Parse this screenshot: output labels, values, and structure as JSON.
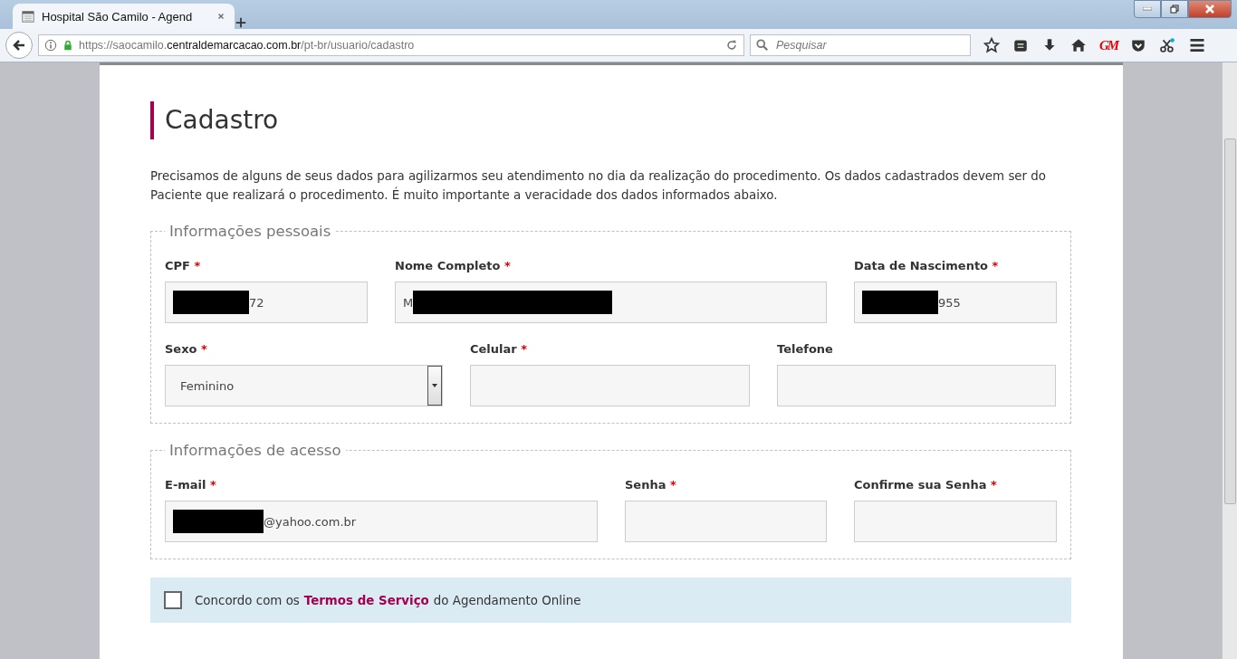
{
  "browser": {
    "tab_title": "Hospital São Camilo - Agend",
    "url": {
      "prefix": "https://saocamilo.",
      "domain": "centraldemarcacao.com.br",
      "path": "/pt-br/usuario/cadastro"
    },
    "search": {
      "placeholder": "Pesquisar"
    },
    "extension_label": "GM"
  },
  "page": {
    "title": "Cadastro",
    "intro": "Precisamos de alguns de seus dados para agilizarmos seu atendimento no dia da realização do procedimento. Os dados cadastrados devem ser do Paciente que realizará o procedimento. É muito importante a veracidade dos dados informados abaixo.",
    "sections": [
      {
        "legend": "Informações pessoais",
        "rows": [
          [
            {
              "kind": "text",
              "label": "CPF",
              "required_mark": "*",
              "value": "72",
              "redacted_before": true
            },
            {
              "kind": "text",
              "label": "Nome Completo",
              "required_mark": "*",
              "value": "M",
              "redacted_after": true
            },
            {
              "kind": "text",
              "label": "Data de Nascimento",
              "required_mark": "*",
              "value": "955",
              "redacted_before": true
            }
          ],
          [
            {
              "kind": "select",
              "label": "Sexo",
              "required_mark": "*",
              "value": "Feminino"
            },
            {
              "kind": "text",
              "label": "Celular",
              "required_mark": "*"
            },
            {
              "kind": "text",
              "label": "Telefone"
            }
          ]
        ]
      },
      {
        "legend": "Informações de acesso",
        "rows": [
          [
            {
              "kind": "text",
              "label": "E-mail",
              "required_mark": "*",
              "value": "@yahoo.com.br",
              "redacted_before": true
            },
            {
              "kind": "password",
              "label": "Senha",
              "required_mark": "*"
            },
            {
              "kind": "password",
              "label": "Confirme sua Senha",
              "required_mark": "*"
            }
          ]
        ]
      }
    ],
    "terms": {
      "checked": false,
      "before": "Concordo com os",
      "link": "Termos de Serviço",
      "after": "do Agendamento Online"
    }
  }
}
